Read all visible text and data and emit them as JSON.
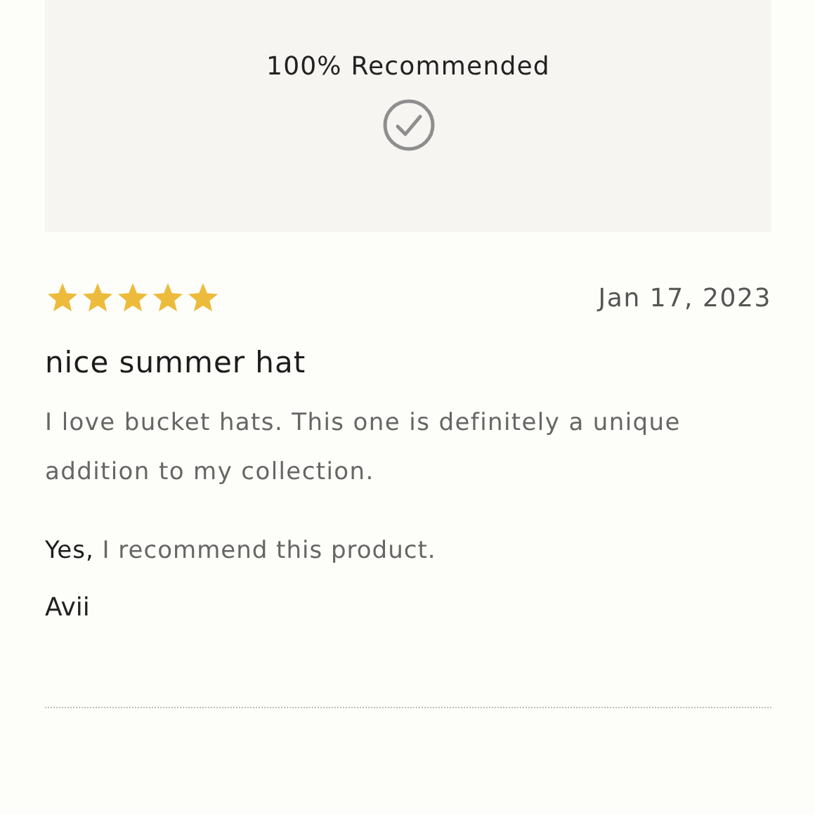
{
  "summary": {
    "label": "100% Recommended"
  },
  "review": {
    "stars": 5,
    "date": "Jan 17, 2023",
    "title": "nice summer hat",
    "body": "I love bucket hats. This one is definitely a unique addition to my collection.",
    "recommendation": "**Yes,** I recommend this product.",
    "author": "Avii"
  }
}
